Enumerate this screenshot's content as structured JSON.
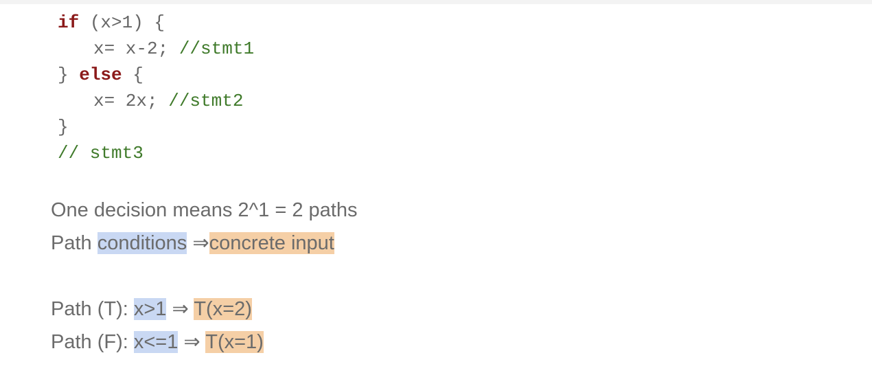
{
  "code": {
    "line1": {
      "kw": "if",
      "rest": " (x>1) {"
    },
    "line2": {
      "code": "x= x-2; ",
      "comment": "//stmt1"
    },
    "line3": {
      "pre": "} ",
      "kw": "else",
      "post": " {"
    },
    "line4": {
      "code": "x= 2x; ",
      "comment": "//stmt2"
    },
    "line5": "}",
    "line6": "// stmt3"
  },
  "text": {
    "decision": "One decision means 2^1 = 2 paths",
    "path_label": "Path ",
    "conditions": "conditions",
    "arrow_concrete": " ⇒",
    "concrete_input": "concrete input",
    "path_t_label": "Path (T): ",
    "path_t_cond": "x>1",
    "path_t_arrow": " ⇒ ",
    "path_t_input": "T(x=2)",
    "path_f_label": "Path (F): ",
    "path_f_cond": "x<=1",
    "path_f_arrow": " ⇒ ",
    "path_f_input": "T(x=1)"
  },
  "colors": {
    "keyword": "#8b1a1a",
    "comment": "#3f7a2a",
    "highlight_condition": "#c9d8f3",
    "highlight_input": "#f5cfa6"
  }
}
